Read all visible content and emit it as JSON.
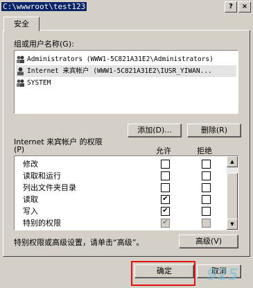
{
  "window": {
    "title": "C:\\wwwroot\\test123",
    "help_glyph": "?",
    "close_glyph": "×"
  },
  "tabs": [
    {
      "label": "安全"
    }
  ],
  "users_group": {
    "label": "组或用户名称(G):",
    "items": [
      {
        "text": "Administrators (WWW1-5C821A31E2\\Administrators)",
        "selected": false
      },
      {
        "text": "Internet 来宾帐户 (WWW1-5C821A31E2\\IUSR_YIWAN...",
        "selected": true
      },
      {
        "text": "SYSTEM",
        "selected": false
      }
    ]
  },
  "buttons": {
    "add": "添加(D)...",
    "remove": "删除(R)",
    "advanced": "高级(V)",
    "ok": "确定",
    "cancel": "取消"
  },
  "permissions": {
    "label": "Internet 来宾帐户 的权限",
    "label_hotkey": "(P)",
    "allow_header": "允许",
    "deny_header": "拒绝",
    "rows": [
      {
        "name": "修改",
        "allow": false,
        "deny": false,
        "disabled": false
      },
      {
        "name": "读取和运行",
        "allow": false,
        "deny": false,
        "disabled": false
      },
      {
        "name": "列出文件夹目录",
        "allow": false,
        "deny": false,
        "disabled": false
      },
      {
        "name": "读取",
        "allow": true,
        "deny": false,
        "disabled": false
      },
      {
        "name": "写入",
        "allow": true,
        "deny": false,
        "disabled": false
      },
      {
        "name": "特别的权限",
        "allow": true,
        "deny": false,
        "disabled": true
      }
    ]
  },
  "advanced_hint": "特别权限或高级设置，请单击“高级”。",
  "watermark": {
    "big": "925",
    "small": "rc"
  },
  "colors": {
    "face": "#d4d0c8",
    "highlight_box": "#e01010"
  }
}
